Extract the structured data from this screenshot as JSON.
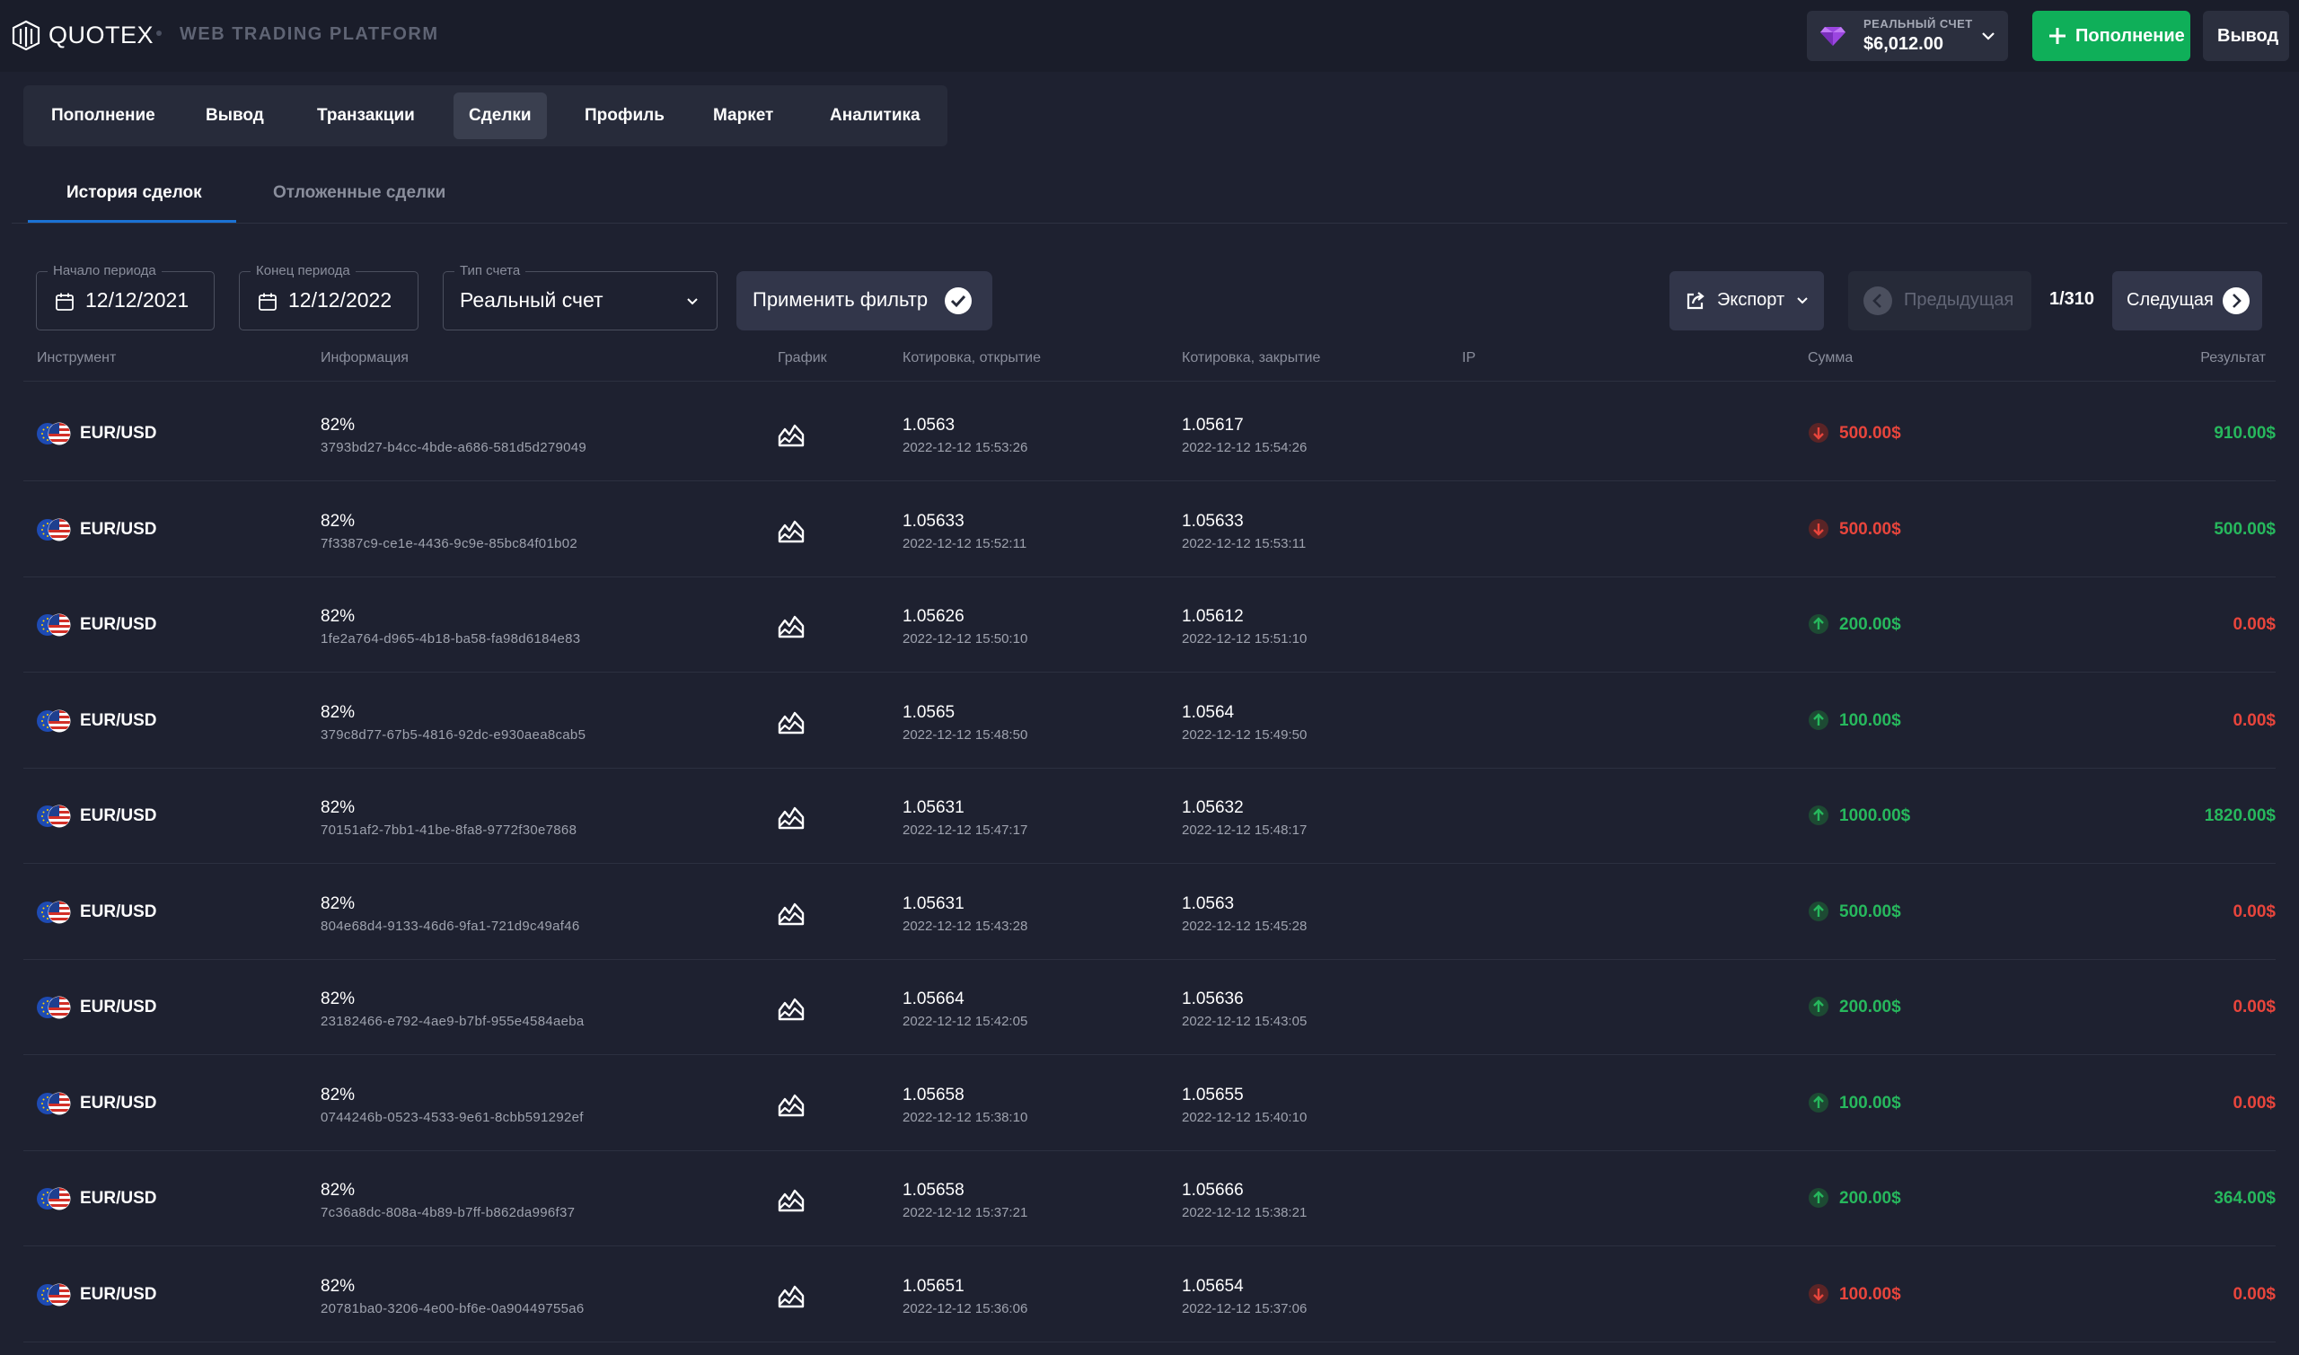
{
  "colors": {
    "green": "#27b85d",
    "red": "#e8453c",
    "deposit_bg": "#0faf59",
    "tab_underline": "#1b72d4"
  },
  "header": {
    "brand": "QUOTEX",
    "platform": "WEB TRADING PLATFORM",
    "account_label": "РЕАЛЬНЫЙ СЧЕТ",
    "account_balance": "$6,012.00",
    "deposit_label": "Пополнение",
    "withdraw_label": "Вывод",
    "icons": [
      "quotex-logo",
      "diamond-icon",
      "chevron-down-icon",
      "plus-icon"
    ]
  },
  "nav": {
    "items": [
      "Пополнение",
      "Вывод",
      "Транзакции",
      "Сделки",
      "Профиль",
      "Маркет",
      "Аналитика"
    ],
    "active": "Сделки"
  },
  "tabs": {
    "history": "История сделок",
    "pending": "Отложенные сделки",
    "active": "История сделок"
  },
  "filters": {
    "start_label": "Начало периода",
    "start_value": "12/12/2021",
    "end_label": "Конец периода",
    "end_value": "12/12/2022",
    "type_label": "Тип счета",
    "type_value": "Реальный счет",
    "apply_label": "Применить фильтр",
    "export_label": "Экспорт",
    "prev_label": "Предыдущая",
    "page_info": "1/310",
    "next_label": "Следущая"
  },
  "table": {
    "columns": {
      "instrument": "Инструмент",
      "info": "Информация",
      "chart": "График",
      "open": "Котировка, открытие",
      "close": "Котировка, закрытие",
      "ip": "IP",
      "amount": "Сумма",
      "result": "Результат"
    },
    "rows": [
      {
        "pair": "EUR/USD",
        "percent": "82%",
        "id": "3793bd27-b4cc-4bde-a686-581d5d279049",
        "open": "1.0563",
        "open_time": "2022-12-12 15:53:26",
        "close": "1.05617",
        "close_time": "2022-12-12 15:54:26",
        "direction": "down",
        "amount": "500.00$",
        "result": "910.00$",
        "result_win": true
      },
      {
        "pair": "EUR/USD",
        "percent": "82%",
        "id": "7f3387c9-ce1e-4436-9c9e-85bc84f01b02",
        "open": "1.05633",
        "open_time": "2022-12-12 15:52:11",
        "close": "1.05633",
        "close_time": "2022-12-12 15:53:11",
        "direction": "down",
        "amount": "500.00$",
        "result": "500.00$",
        "result_win": true
      },
      {
        "pair": "EUR/USD",
        "percent": "82%",
        "id": "1fe2a764-d965-4b18-ba58-fa98d6184e83",
        "open": "1.05626",
        "open_time": "2022-12-12 15:50:10",
        "close": "1.05612",
        "close_time": "2022-12-12 15:51:10",
        "direction": "up",
        "amount": "200.00$",
        "result": "0.00$",
        "result_win": false
      },
      {
        "pair": "EUR/USD",
        "percent": "82%",
        "id": "379c8d77-67b5-4816-92dc-e930aea8cab5",
        "open": "1.0565",
        "open_time": "2022-12-12 15:48:50",
        "close": "1.0564",
        "close_time": "2022-12-12 15:49:50",
        "direction": "up",
        "amount": "100.00$",
        "result": "0.00$",
        "result_win": false
      },
      {
        "pair": "EUR/USD",
        "percent": "82%",
        "id": "70151af2-7bb1-41be-8fa8-9772f30e7868",
        "open": "1.05631",
        "open_time": "2022-12-12 15:47:17",
        "close": "1.05632",
        "close_time": "2022-12-12 15:48:17",
        "direction": "up",
        "amount": "1000.00$",
        "result": "1820.00$",
        "result_win": true
      },
      {
        "pair": "EUR/USD",
        "percent": "82%",
        "id": "804e68d4-9133-46d6-9fa1-721d9c49af46",
        "open": "1.05631",
        "open_time": "2022-12-12 15:43:28",
        "close": "1.0563",
        "close_time": "2022-12-12 15:45:28",
        "direction": "up",
        "amount": "500.00$",
        "result": "0.00$",
        "result_win": false
      },
      {
        "pair": "EUR/USD",
        "percent": "82%",
        "id": "23182466-e792-4ae9-b7bf-955e4584aeba",
        "open": "1.05664",
        "open_time": "2022-12-12 15:42:05",
        "close": "1.05636",
        "close_time": "2022-12-12 15:43:05",
        "direction": "up",
        "amount": "200.00$",
        "result": "0.00$",
        "result_win": false
      },
      {
        "pair": "EUR/USD",
        "percent": "82%",
        "id": "0744246b-0523-4533-9e61-8cbb591292ef",
        "open": "1.05658",
        "open_time": "2022-12-12 15:38:10",
        "close": "1.05655",
        "close_time": "2022-12-12 15:40:10",
        "direction": "up",
        "amount": "100.00$",
        "result": "0.00$",
        "result_win": false
      },
      {
        "pair": "EUR/USD",
        "percent": "82%",
        "id": "7c36a8dc-808a-4b89-b7ff-b862da996f37",
        "open": "1.05658",
        "open_time": "2022-12-12 15:37:21",
        "close": "1.05666",
        "close_time": "2022-12-12 15:38:21",
        "direction": "up",
        "amount": "200.00$",
        "result": "364.00$",
        "result_win": true
      },
      {
        "pair": "EUR/USD",
        "percent": "82%",
        "id": "20781ba0-3206-4e00-bf6e-0a90449755a6",
        "open": "1.05651",
        "open_time": "2022-12-12 15:36:06",
        "close": "1.05654",
        "close_time": "2022-12-12 15:37:06",
        "direction": "down",
        "amount": "100.00$",
        "result": "0.00$",
        "result_win": false
      }
    ]
  }
}
